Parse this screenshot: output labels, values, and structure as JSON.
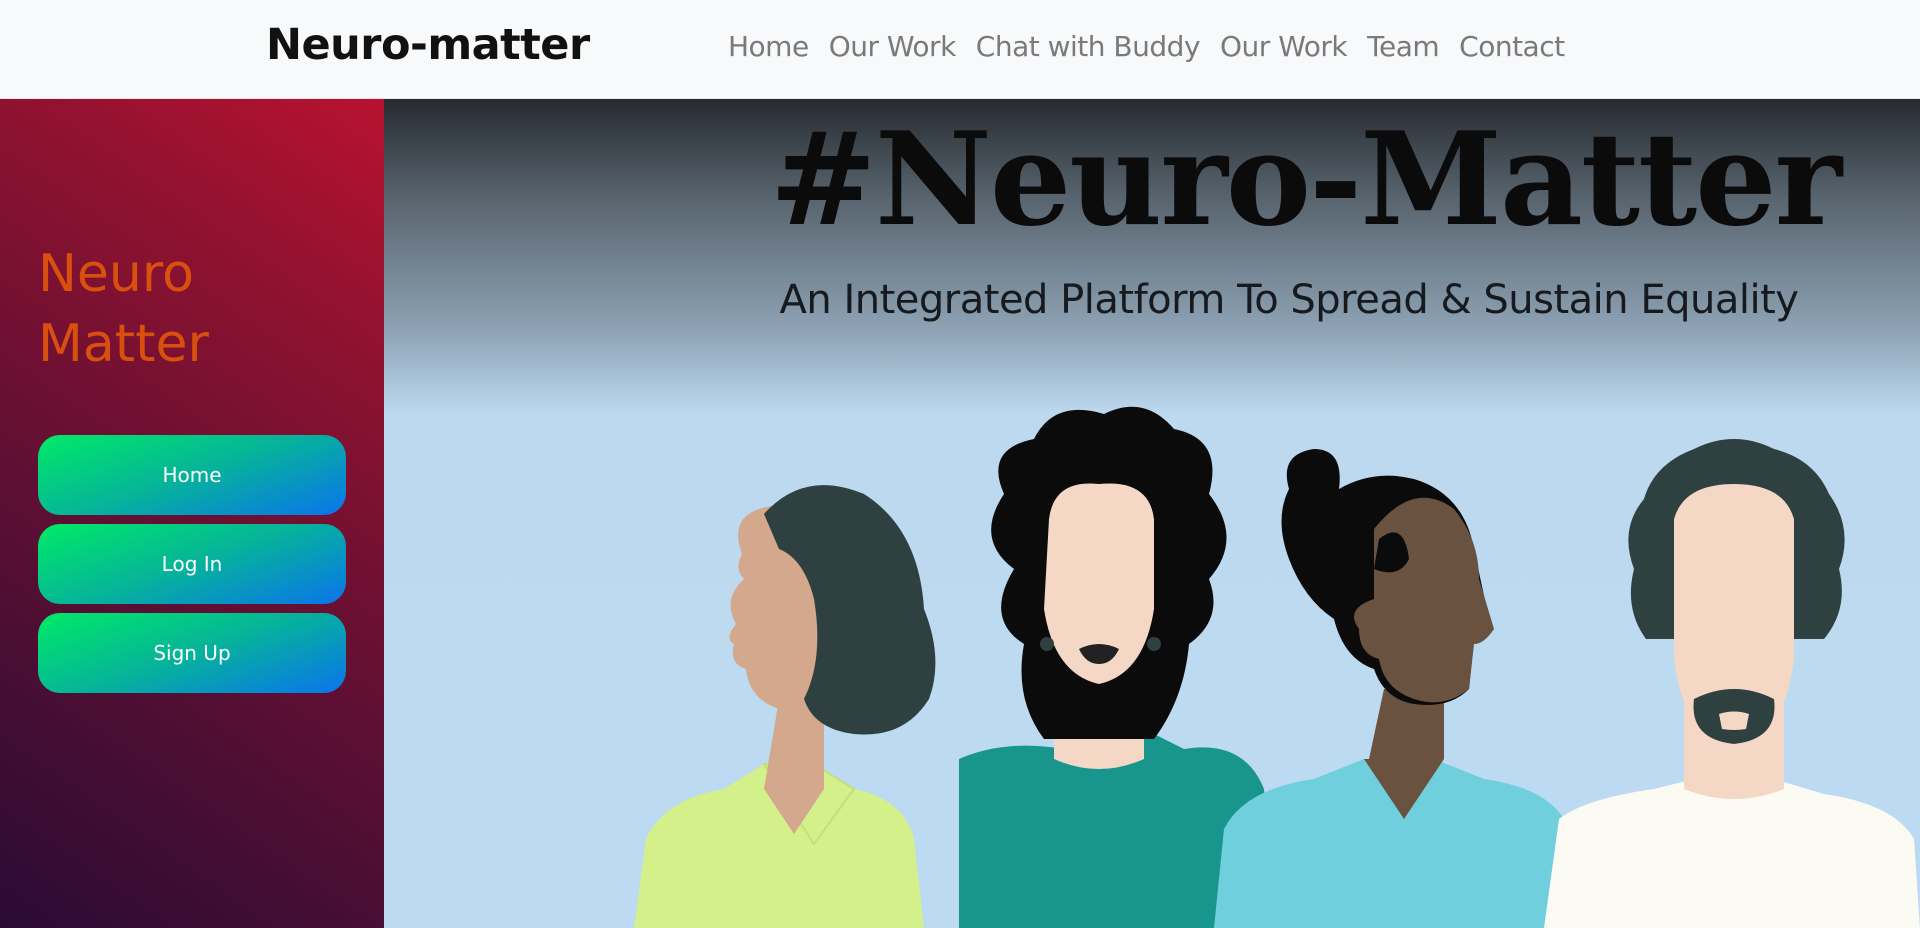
{
  "navbar": {
    "brand": "Neuro-matter",
    "links": [
      "Home",
      "Our Work",
      "Chat with Buddy",
      "Our Work",
      "Team",
      "Contact"
    ]
  },
  "sidebar": {
    "title": "Neuro Matter",
    "buttons": [
      "Home",
      "Log In",
      "Sign Up"
    ]
  },
  "hero": {
    "title": "#Neuro-Matter",
    "subtitle": "An Integrated Platform To Spread & Sustain Equality",
    "illustration": "four-people-illustration"
  },
  "colors": {
    "navbar_bg": "#f8f9fa",
    "sidebar_title": "#d9500e",
    "button_gradient_start": "#00ea66",
    "button_gradient_end": "#0a74ec",
    "hero_sky": "#bcdaf1"
  }
}
